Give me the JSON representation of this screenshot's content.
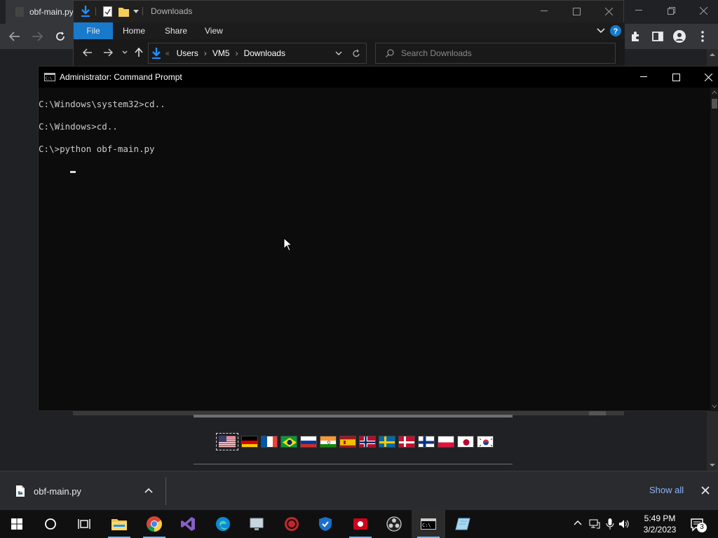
{
  "chrome": {
    "tab_title": "obf-main.py"
  },
  "explorer": {
    "title": "Downloads",
    "ribbon_tabs": [
      "File",
      "Home",
      "Share",
      "View"
    ],
    "breadcrumb": [
      "Users",
      "VM5",
      "Downloads"
    ],
    "search_placeholder": "Search Downloads"
  },
  "cmd": {
    "title": "Administrator: Command Prompt",
    "lines": [
      "C:\\Windows\\system32>cd..",
      "C:\\Windows>cd..",
      "C:\\>python obf-main.py"
    ]
  },
  "download_bar": {
    "file_name": "obf-main.py",
    "show_all": "Show all"
  },
  "taskbar": {
    "time": "5:49 PM",
    "date": "3/2/2023",
    "notification_count": "3",
    "accent": "#76b9ed"
  }
}
